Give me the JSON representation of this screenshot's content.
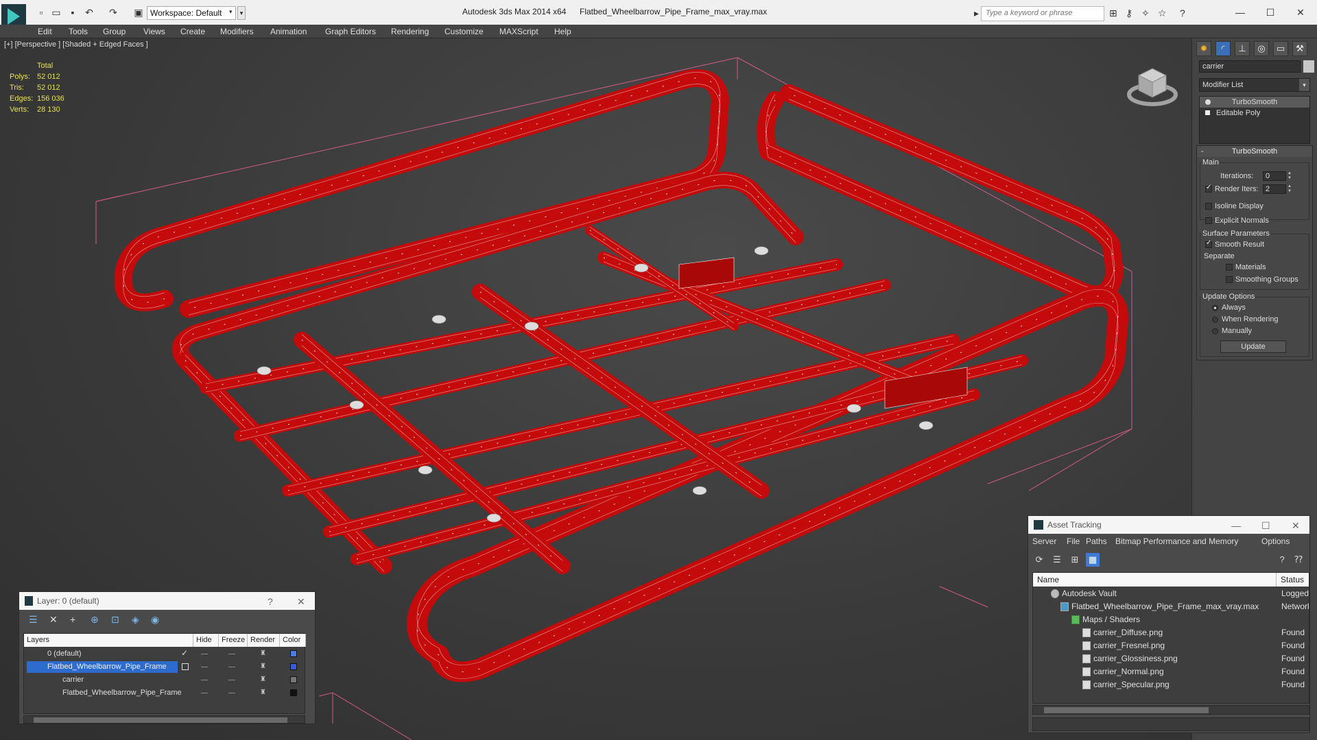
{
  "titlebar": {
    "workspace": "Workspace: Default",
    "app_title": "Autodesk 3ds Max  2014 x64",
    "file_title": "Flatbed_Wheelbarrow_Pipe_Frame_max_vray.max",
    "search_placeholder": "Type a keyword or phrase"
  },
  "menu": [
    "Edit",
    "Tools",
    "Group",
    "Views",
    "Create",
    "Modifiers",
    "Animation",
    "Graph Editors",
    "Rendering",
    "Customize",
    "MAXScript",
    "Help"
  ],
  "viewport": {
    "label": "[+] [Perspective ] [Shaded + Edged Faces ]",
    "stats": {
      "header": "Total",
      "polys_label": "Polys:",
      "polys": "52 012",
      "tris_label": "Tris:",
      "tris": "52 012",
      "edges_label": "Edges:",
      "edges": "156 036",
      "verts_label": "Verts:",
      "verts": "28 130"
    },
    "colors": {
      "frame": "#c40a0a",
      "wire": "#ffffff",
      "bbox": "#d45a8a"
    }
  },
  "command_panel": {
    "object_name": "carrier",
    "modifier_list": "Modifier List",
    "stack": [
      "TurboSmooth",
      "Editable Poly"
    ],
    "turbosmooth": {
      "title": "TurboSmooth",
      "main_label": "Main",
      "iterations_label": "Iterations:",
      "iterations": "0",
      "render_iters_label": "Render Iters:",
      "render_iters": "2",
      "isoline": "Isoline Display",
      "explicit_normals": "Explicit Normals",
      "surface_label": "Surface Parameters",
      "smooth_result": "Smooth Result",
      "separate_label": "Separate",
      "materials": "Materials",
      "smoothing_groups": "Smoothing Groups",
      "update_label": "Update Options",
      "always": "Always",
      "when_rendering": "When Rendering",
      "manually": "Manually",
      "update_button": "Update"
    }
  },
  "layer_window": {
    "title": "Layer: 0 (default)",
    "columns": [
      "Layers",
      "Hide",
      "Freeze",
      "Render",
      "Color"
    ],
    "rows": [
      {
        "name": "0 (default)",
        "color": "#4a7de0"
      },
      {
        "name": "Flatbed_Wheelbarrow_Pipe_Frame",
        "color": "#3a5ad8"
      },
      {
        "name": "carrier",
        "color": "#777777"
      },
      {
        "name": "Flatbed_Wheelbarrow_Pipe_Frame",
        "color": "#111111"
      }
    ]
  },
  "asset_window": {
    "title": "Asset Tracking",
    "menu": [
      "Server",
      "File",
      "Paths",
      "Bitmap Performance and Memory",
      "Options"
    ],
    "columns": [
      "Name",
      "Status"
    ],
    "rows": [
      {
        "name": "Autodesk Vault",
        "status": "Logged O"
      },
      {
        "name": "Flatbed_Wheelbarrow_Pipe_Frame_max_vray.max",
        "status": "Network"
      },
      {
        "name": "Maps / Shaders",
        "status": ""
      },
      {
        "name": "carrier_Diffuse.png",
        "status": "Found"
      },
      {
        "name": "carrier_Fresnel.png",
        "status": "Found"
      },
      {
        "name": "carrier_Glossiness.png",
        "status": "Found"
      },
      {
        "name": "carrier_Normal.png",
        "status": "Found"
      },
      {
        "name": "carrier_Specular.png",
        "status": "Found"
      }
    ]
  }
}
